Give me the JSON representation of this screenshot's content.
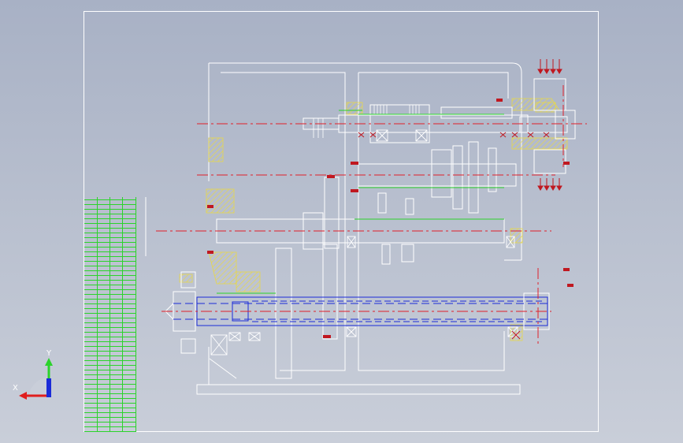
{
  "viewport": {
    "background": "#b4bccc"
  },
  "sheet": {
    "border_color": "#ffffff"
  },
  "colors": {
    "outline": "#ffffff",
    "centerline": "#e0202a",
    "hidden_line": "#1b2bd8",
    "section_hatch": "#e8d84a",
    "accent_green": "#2bd32b",
    "dimension": "#c01820"
  },
  "triad": {
    "x_label": "X",
    "y_label": "Y"
  }
}
